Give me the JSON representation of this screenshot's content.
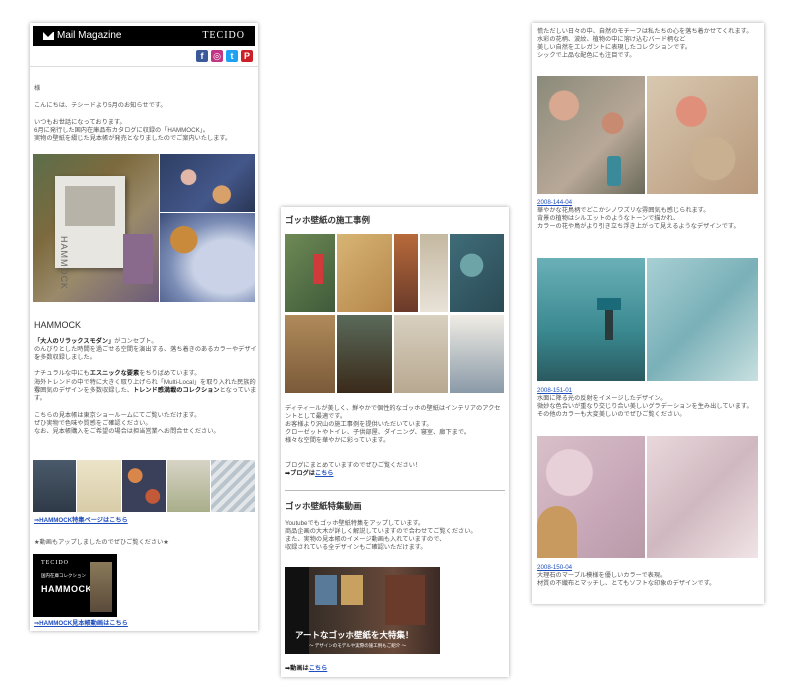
{
  "p1": {
    "mail_magazine": "Mail Magazine",
    "brand": "TECIDO",
    "social": [
      "f",
      "◎",
      "t",
      "P"
    ],
    "sama": "様",
    "greeting": "こんにちは、テシードより5月のお知らせです。",
    "intro1": "いつもお世話になっております。",
    "intro2": "6月に発行した国内在庫品布カタログに収録の「HAMMOCK」。",
    "intro3": "実物の壁紙を綴じた見本帳が発売となりましたのでご案内いたします。",
    "book_title": "HAMMOCK",
    "title": "HAMMOCK",
    "concept_b": "「大人のリラックスモダン」",
    "concept_rest": "がコンセプト。",
    "concept2": "のんびりとした時間を過ごせる空間を演出する、落ち着きのあるカラーやデザイン",
    "concept3": "を多数収録しました。",
    "nat1a": "ナチュラルな中にも",
    "nat1b": "エスニックな要素",
    "nat1c": "をちりばめています。",
    "nat2": "海外トレンドの中で特に大きく取り上げられ「Multi-Local」を取り入れた民族的な",
    "nat3": "雰囲気のデザインを多数収録した、",
    "nat3b": "トレンド感満載のコレクション",
    "nat3c": "となっていま",
    "nat4": "す。",
    "show1": "こちらの見本帳は東京ショールームにてご覧いただけます。",
    "show2": "ぜひ実物で色味や質感をご確認ください。",
    "show3": "なお、見本帳購入をご希望の場合は担当営業へお問合せください。",
    "link1": "⇒HAMMOCK特集ページはこちら",
    "video_note": "★動画もアップしましたのでぜひご覧ください★",
    "thumb_brand": "TECIDO",
    "thumb_sub": "国内在庫コレクション",
    "thumb_title": "HAMMOCK",
    "link2": "⇒HAMMOCK見本帳動画はこちら"
  },
  "p2": {
    "heading1": "ゴッホ壁紙の施工事例",
    "d1": "ディティールが美しく、鮮やかで個性的なゴッホの壁紙はインテリアのアクセ",
    "d1b": "ントとして最適です。",
    "d2": "お客様より沢山の施工事例を提供いただいています。",
    "d3": "クローゼットやトイレ、子供部屋、ダイニング、寝室、廊下まで。",
    "d4": "様々な空間を華やかに彩っています。",
    "d5": "ブログにまとめていますのでぜひご覧ください！",
    "blog_pre": "➡ブログは",
    "blog_link": "こちら",
    "heading2": "ゴッホ壁紙特集動画",
    "v1": "Youtubeでもゴッホ壁紙特集をアップしています。",
    "v2": "商品企画の大木が詳しく解説していますので合わせてご覧ください。",
    "v3": "また、実物の見本帳のイメージ動画も入れていますので、",
    "v4": "収録されている全デザインもご確認いただけます。",
    "video_title": "アートなゴッホ壁紙を大特集！",
    "video_sub": "～ デザインのモデルや実際の施工例もご紹介 ～",
    "video_pre": "➡動画は",
    "video_link": "こちら"
  },
  "p3": {
    "top1": "慌ただしい日々の中、自然のモチーフは私たちの心を落ち着かせてくれます。",
    "top2": "水彩の花柄、波紋、植物の中に溶け込むバード柄など",
    "top3": "美しい自然をエレガントに表現したコレクションです。",
    "top4": "シックで上品な配色にも注目です。",
    "c1": "2008-144-04",
    "c1a": "華やかな花鳥柄でどこかシノワズリな雰囲気も感じられます。",
    "c1b": "背景の植物はシルエットのようなトーンで描かれ、",
    "c1c": "カラーの花や鳥がより引き立ち浮き上がって見えるようなデザインです。",
    "c2": "2008-151-01",
    "c2a": "水面に降る光の反射をイメージしたデザイン。",
    "c2b": "微妙な色合いが重なり交じり合い美しいグラデーションを生み出しています。",
    "c2c": "その他のカラーも大変美しいのでぜひご覧ください。",
    "c3": "2008-150-04",
    "c3a": "大理石のマーブル模様を優しいカラーで表現。",
    "c3b": "材質の不織布とマッチし、とてもソフトな印象のデザインです。"
  },
  "colors": {
    "link": "#1f4fbf",
    "facebook": "#3b5998",
    "instagram": "#c13584",
    "twitter": "#1da1f2",
    "pinterest": "#cb2027"
  }
}
